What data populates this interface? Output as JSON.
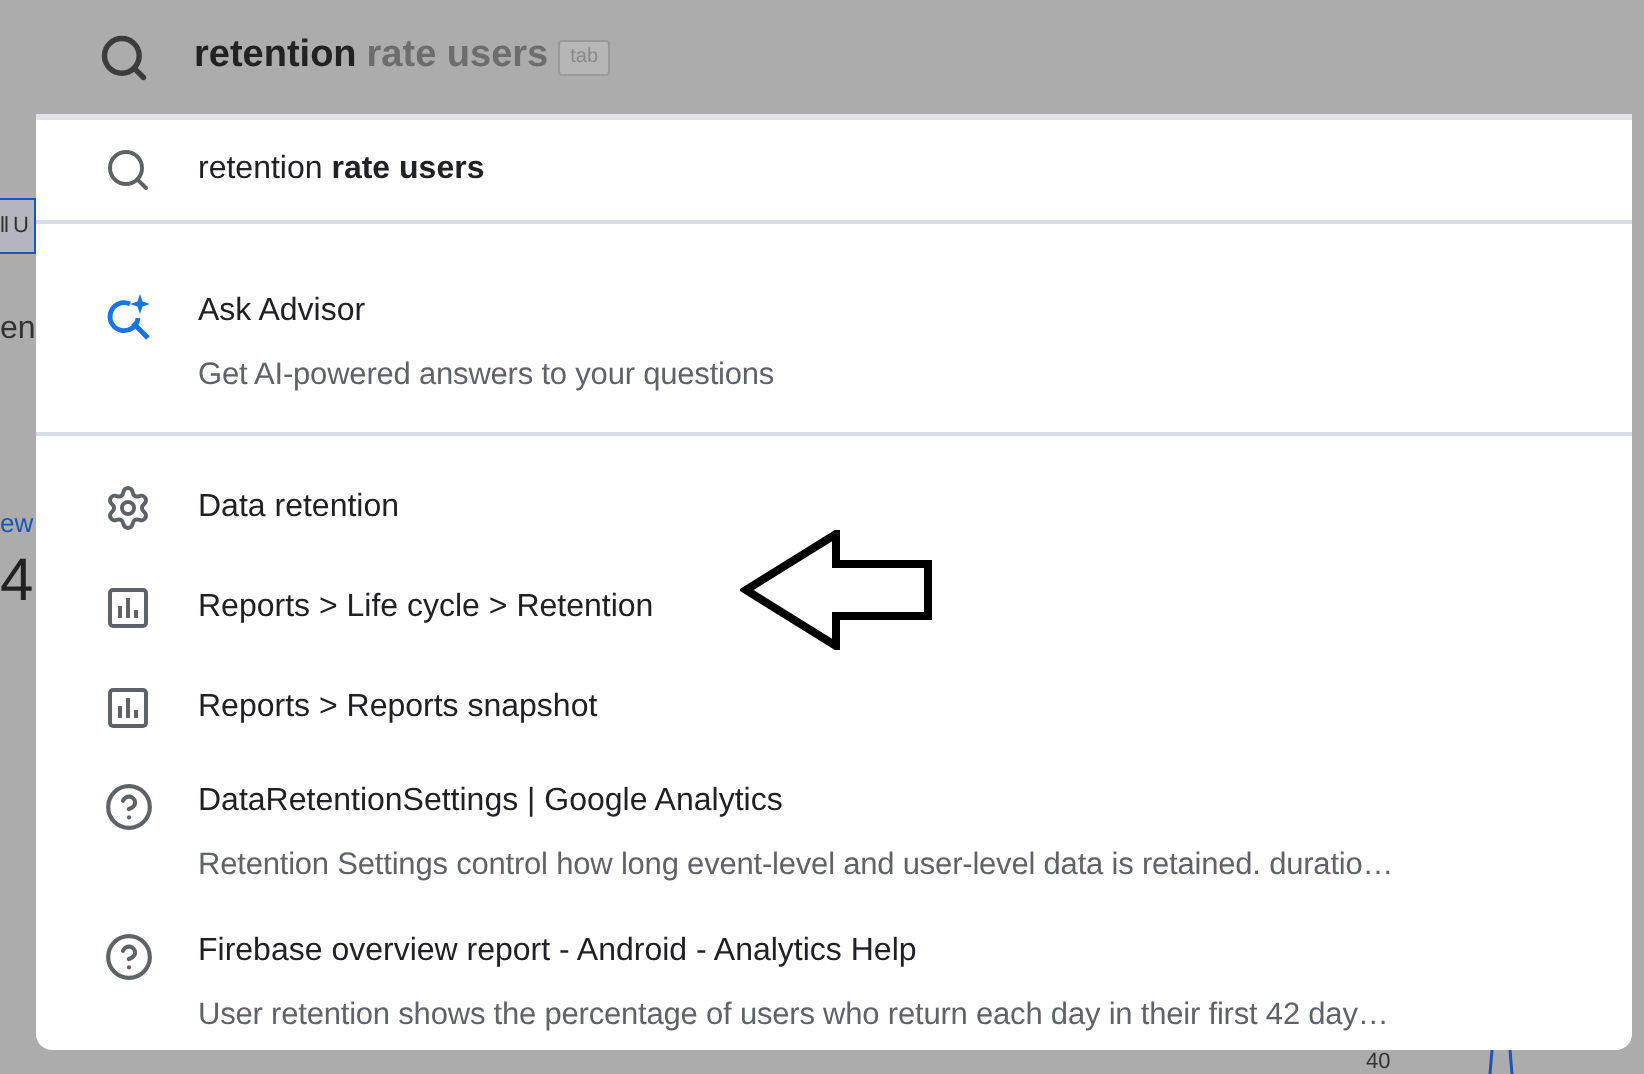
{
  "search": {
    "typed": "retention",
    "completion": "rate users",
    "hint": "tab"
  },
  "background": {
    "fragments": [
      {
        "kind": "button",
        "text": "ll U"
      },
      {
        "kind": "heading",
        "text": "en"
      },
      {
        "kind": "link",
        "text": "ew"
      },
      {
        "kind": "number",
        "text": "4"
      }
    ],
    "axis_label": "40"
  },
  "dropdown": {
    "sections": [
      [
        {
          "kind": "suggestion",
          "title": "retention **rate users**"
        }
      ],
      [
        {
          "kind": "advisor",
          "title": "Ask Advisor",
          "subtitle": "Get AI-powered answers to your questions"
        }
      ],
      [
        {
          "kind": "setting",
          "title": "Data retention"
        },
        {
          "kind": "report",
          "title": "Reports > Life cycle > Retention"
        },
        {
          "kind": "report",
          "title": "Reports > Reports snapshot"
        },
        {
          "kind": "help",
          "title": "DataRetentionSettings | Google Analytics",
          "subtitle": "Retention Settings control how long event-level and user-level data is retained. duratio…"
        },
        {
          "kind": "help",
          "title": "Firebase overview report - Android - Analytics Help",
          "subtitle": "User retention shows the percentage of users who return each day in their first 42 day…"
        }
      ]
    ]
  }
}
